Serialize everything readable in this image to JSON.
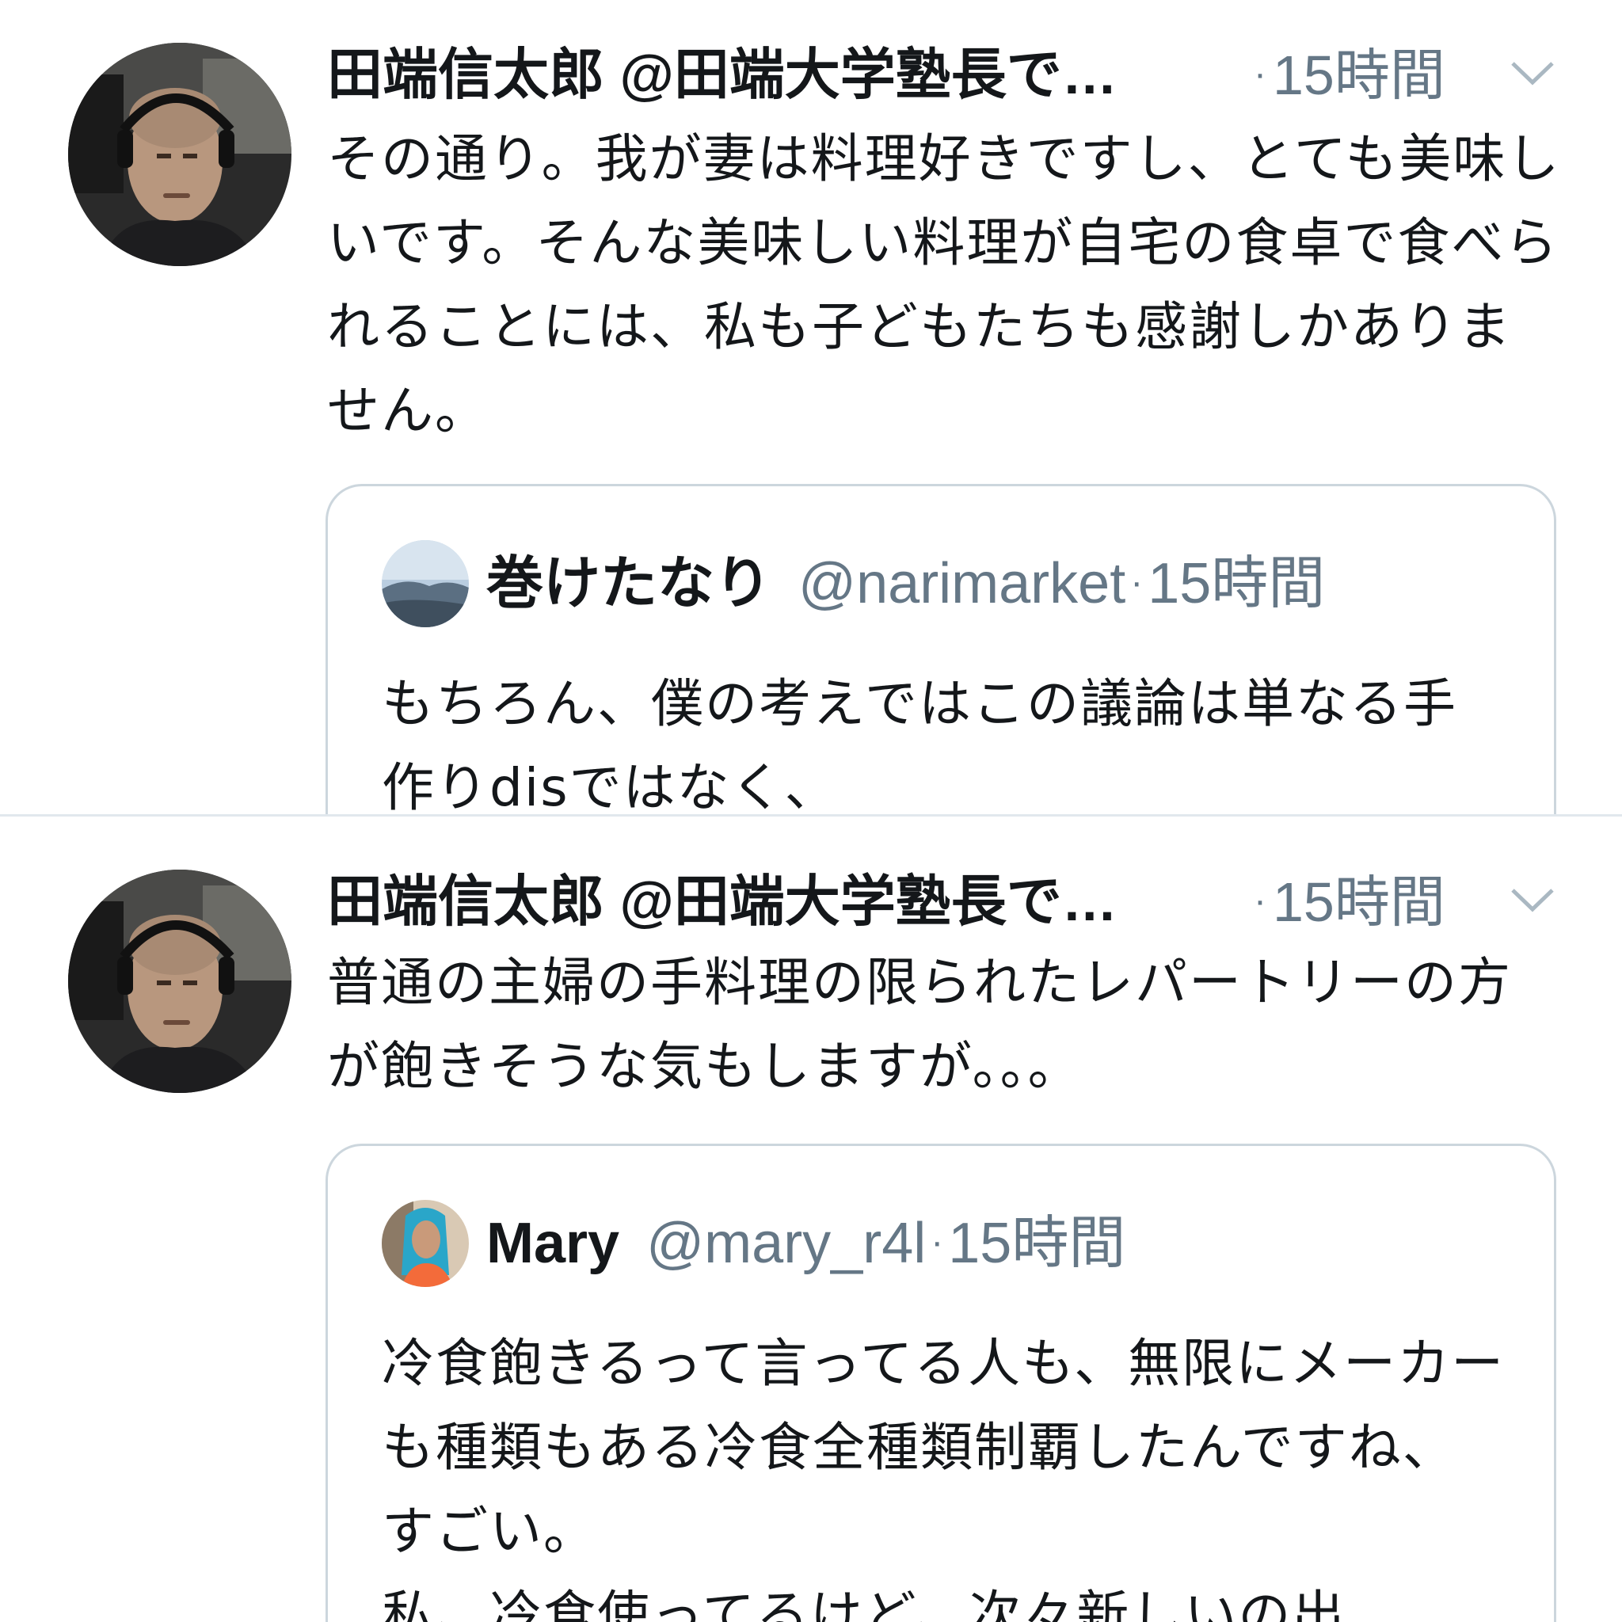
{
  "tweets": [
    {
      "author_display": "田端信太郎 @田端大学塾長で…",
      "time": "15時間",
      "separator": "·",
      "avatar_icon": "profile-photo-man-headphones",
      "caret_icon": "chevron-down-icon",
      "body": "その通り。我が妻は料理好きですし、とても美味しいです。そんな美味しい料理が自宅の食卓で食べられることには、私も子どもたちも感謝しかありません。",
      "quote": {
        "avatar_icon": "profile-photo-landscape",
        "name": "巻けたなり",
        "handle": "@narimarket",
        "separator": "·",
        "time": "15時間",
        "body": "もちろん、僕の考えではこの議論は単なる手作りdisではなく、"
      }
    },
    {
      "author_display": "田端信太郎 @田端大学塾長で…",
      "time": "15時間",
      "separator": "·",
      "avatar_icon": "profile-photo-man-headphones",
      "caret_icon": "chevron-down-icon",
      "body": "普通の主婦の手料理の限られたレパートリーの方が飽きそうな気もしますが。。。",
      "quote": {
        "avatar_icon": "profile-photo-woman-blue-hair",
        "name": "Mary",
        "handle": "@mary_r4l",
        "separator": "·",
        "time": "15時間",
        "body": "冷食飽きるって言ってる人も、無限にメーカーも種類もある冷食全種類制覇したんですね、すごい。\n私、冷食使ってるけど、次々新しいの出"
      }
    }
  ],
  "colors": {
    "text_primary": "#14171a",
    "text_secondary": "#657786",
    "border": "#ccd6dd",
    "divider": "#e1e8ed"
  }
}
